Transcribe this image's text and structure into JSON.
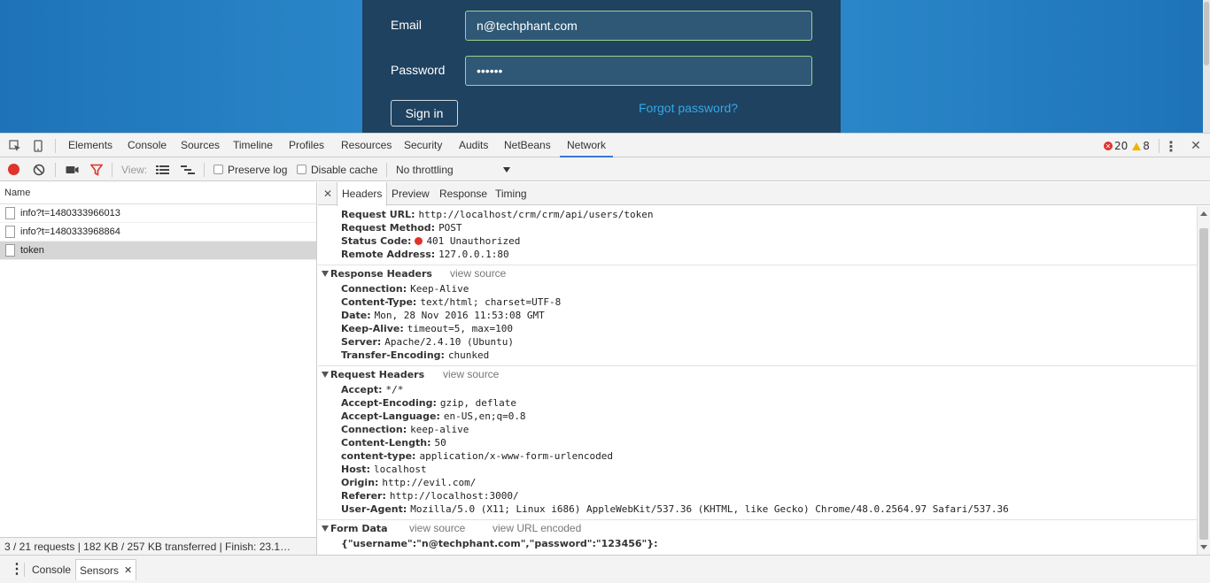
{
  "login": {
    "email_label": "Email",
    "email_value": "n@techphant.com",
    "password_label": "Password",
    "password_value": "••••••",
    "signin_label": "Sign in",
    "forgot_label": "Forgot password?"
  },
  "devtools": {
    "tabs": [
      "Elements",
      "Console",
      "Sources",
      "Timeline",
      "Profiles",
      "Resources",
      "Security",
      "Audits",
      "NetBeans",
      "Network"
    ],
    "active_tab": "Network",
    "errors": "20",
    "warnings": "8",
    "menu_icon": "⋮",
    "close_icon": "✕"
  },
  "network_toolbar": {
    "view_label": "View:",
    "preserve_log": "Preserve log",
    "disable_cache": "Disable cache",
    "throttling": "No throttling"
  },
  "request_list": {
    "header": "Name",
    "rows": [
      "info?t=1480333966013",
      "info?t=1480333968864",
      "token"
    ],
    "selected": "token"
  },
  "details": {
    "close": "✕",
    "tabs": [
      "Headers",
      "Preview",
      "Response",
      "Timing"
    ],
    "active_tab": "Headers",
    "general": [
      {
        "k": "Request URL:",
        "v": "http://localhost/crm/crm/api/users/token"
      },
      {
        "k": "Request Method:",
        "v": "POST"
      },
      {
        "k": "Status Code:",
        "v": "401 Unauthorized"
      },
      {
        "k": "Remote Address:",
        "v": "127.0.0.1:80"
      }
    ],
    "response_headers_title": "Response Headers",
    "view_source": "view source",
    "view_url_encoded": "view URL encoded",
    "response_headers": [
      {
        "k": "Connection:",
        "v": "Keep-Alive"
      },
      {
        "k": "Content-Type:",
        "v": "text/html; charset=UTF-8"
      },
      {
        "k": "Date:",
        "v": "Mon, 28 Nov 2016 11:53:08 GMT"
      },
      {
        "k": "Keep-Alive:",
        "v": "timeout=5, max=100"
      },
      {
        "k": "Server:",
        "v": "Apache/2.4.10 (Ubuntu)"
      },
      {
        "k": "Transfer-Encoding:",
        "v": "chunked"
      }
    ],
    "request_headers_title": "Request Headers",
    "request_headers": [
      {
        "k": "Accept:",
        "v": "*/*"
      },
      {
        "k": "Accept-Encoding:",
        "v": "gzip, deflate"
      },
      {
        "k": "Accept-Language:",
        "v": "en-US,en;q=0.8"
      },
      {
        "k": "Connection:",
        "v": "keep-alive"
      },
      {
        "k": "Content-Length:",
        "v": "50"
      },
      {
        "k": "content-type:",
        "v": "application/x-www-form-urlencoded"
      },
      {
        "k": "Host:",
        "v": "localhost"
      },
      {
        "k": "Origin:",
        "v": "http://evil.com/"
      },
      {
        "k": "Referer:",
        "v": "http://localhost:3000/"
      },
      {
        "k": "User-Agent:",
        "v": "Mozilla/5.0 (X11; Linux i686) AppleWebKit/537.36 (KHTML, like Gecko) Chrome/48.0.2564.97 Safari/537.36"
      }
    ],
    "form_data_title": "Form Data",
    "form_data": "{\"username\":\"n@techphant.com\",\"password\":\"123456\"}:"
  },
  "status_bar": {
    "text": "3 / 21 requests  |  182 KB / 257 KB transferred  |  Finish: 23.1…"
  },
  "drawer": {
    "menu_icon": "⋮",
    "tabs": [
      "Console",
      "Sensors"
    ],
    "active_tab": "Sensors",
    "close_icon": "✕"
  }
}
